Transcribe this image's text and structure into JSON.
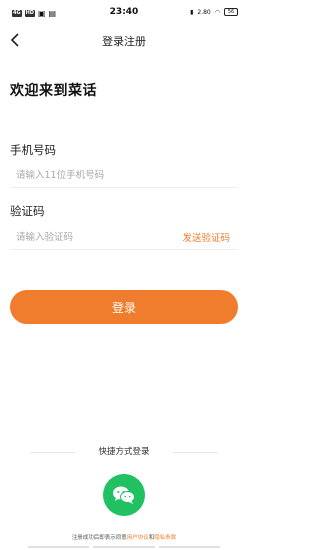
{
  "status_bar": {
    "left_tags": [
      "4G",
      "HD"
    ],
    "time": "23:40",
    "speed": "2.80",
    "battery": "56"
  },
  "nav": {
    "title": "登录注册",
    "back_icon": "chevron-left-icon"
  },
  "welcome": "欢迎来到菜话",
  "phone": {
    "label": "手机号码",
    "placeholder": "请输入11位手机号码",
    "value": ""
  },
  "code": {
    "label": "验证码",
    "placeholder": "请输入验证码",
    "value": "",
    "send_label": "发送验证码"
  },
  "login_button": "登录",
  "quick_login": {
    "label": "快捷方式登录",
    "wechat_icon": "wechat-icon"
  },
  "agreement": {
    "prefix": "注册成功后即表示同意",
    "user_agreement": "用户协议",
    "and": "和",
    "privacy_policy": "隐私条款"
  },
  "colors": {
    "accent": "#f07d2e",
    "wechat": "#20c160"
  }
}
